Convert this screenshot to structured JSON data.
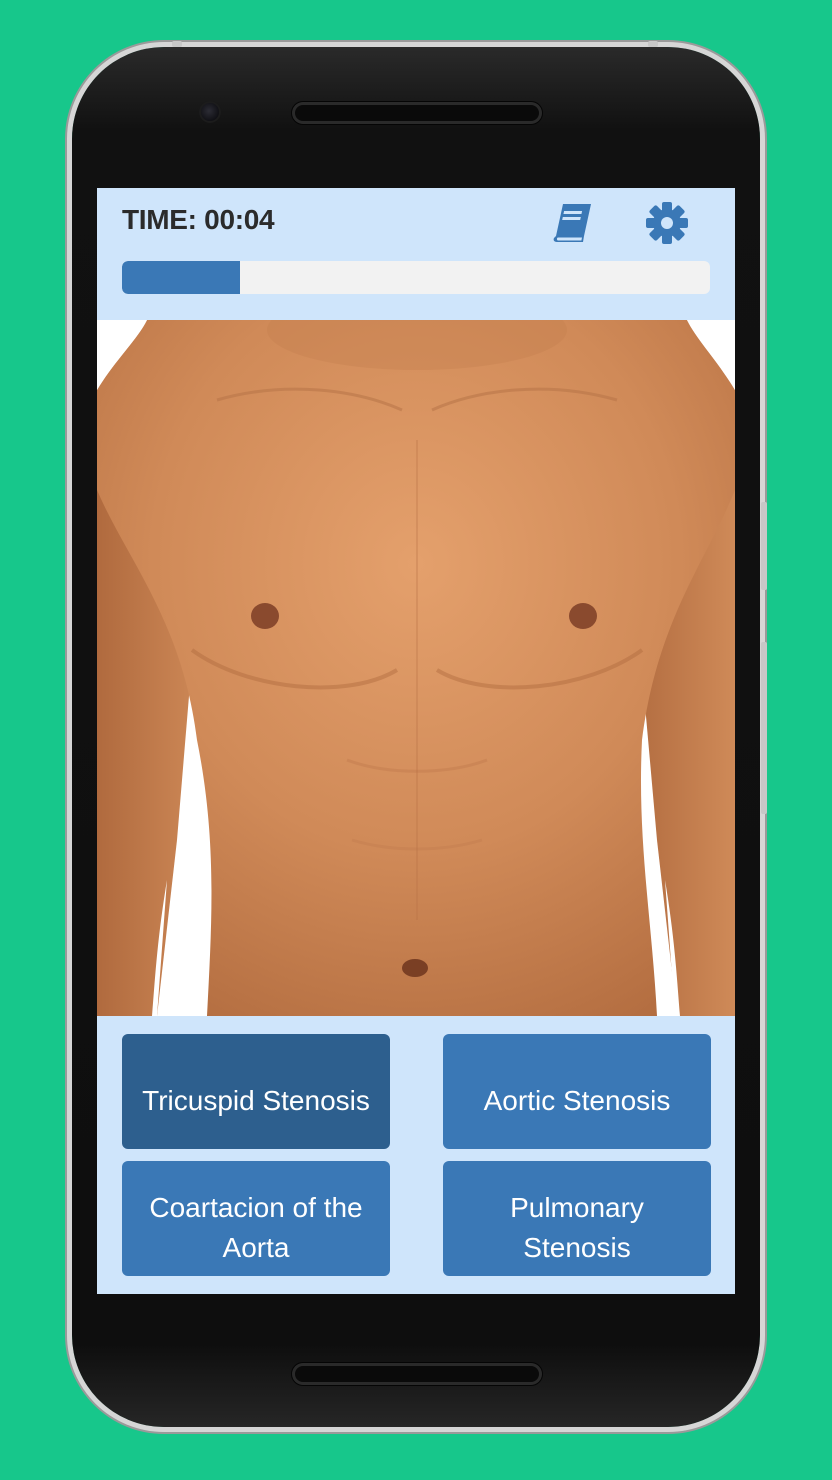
{
  "header": {
    "timer_label": "TIME: 00:04",
    "progress_fraction": 0.2,
    "icons": [
      "book-icon",
      "gear-icon"
    ]
  },
  "image": {
    "subject": "bare-torso-chest"
  },
  "answers": [
    {
      "label": "Tricuspid Stenosis",
      "selected": true
    },
    {
      "label": "Aortic Stenosis",
      "selected": false
    },
    {
      "label": "Coartacion of the Aorta",
      "selected": false
    },
    {
      "label": "Pulmonary Stenosis",
      "selected": false
    }
  ],
  "colors": {
    "background": "#17c78b",
    "panel": "#cfe5fb",
    "accent": "#3a78b6",
    "accent_selected": "#2d5f8e",
    "skin": "#d38e5c"
  }
}
